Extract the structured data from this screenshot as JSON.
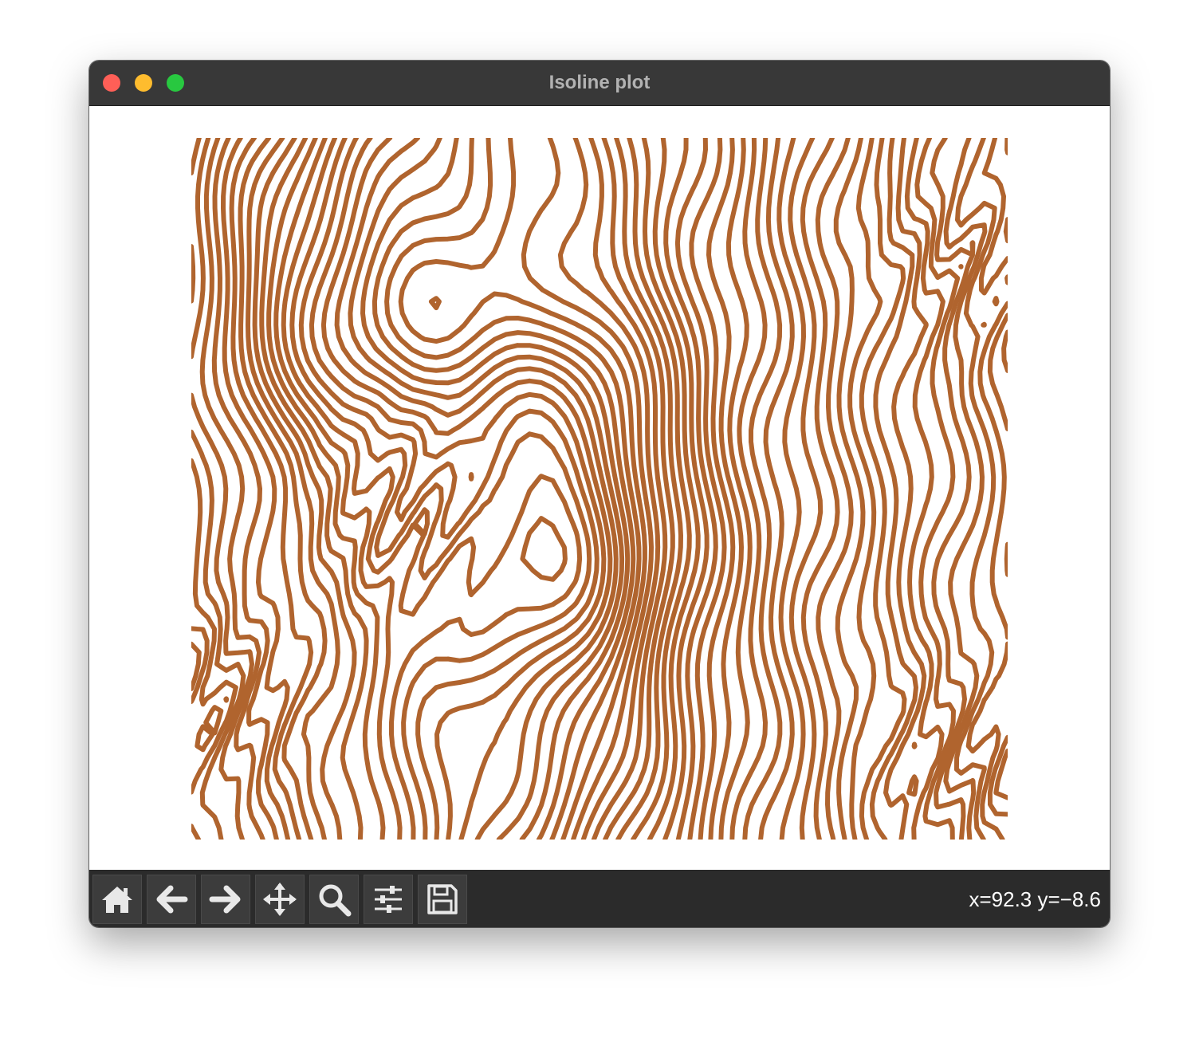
{
  "window": {
    "title": "Isoline plot",
    "traffic_lights": {
      "close": "#ff5f57",
      "minimize": "#febc2e",
      "zoom": "#28c840"
    }
  },
  "toolbar": {
    "buttons": [
      {
        "name": "home-button",
        "icon": "home-icon"
      },
      {
        "name": "back-button",
        "icon": "arrow-left-icon"
      },
      {
        "name": "forward-button",
        "icon": "arrow-right-icon"
      },
      {
        "name": "pan-button",
        "icon": "move-arrows-icon"
      },
      {
        "name": "zoom-button",
        "icon": "magnifier-icon"
      },
      {
        "name": "configure-subplots-button",
        "icon": "sliders-icon"
      },
      {
        "name": "save-button",
        "icon": "floppy-disk-icon"
      }
    ],
    "coordinates": "x=92.3 y=−8.6"
  },
  "colors": {
    "titlebar": "#383838",
    "toolbar": "#2b2b2b",
    "isoline": "#b0642e"
  },
  "chart_data": {
    "type": "contour",
    "line_color": "#b0642e",
    "axes_visible": false,
    "grid": false,
    "legend": "none",
    "features": {
      "basin": {
        "x": 0.46,
        "y": 0.55
      },
      "dense_zones": [
        {
          "x": 0.04,
          "y": 0.8
        },
        {
          "x": 0.96,
          "y": 0.18
        },
        {
          "x": 0.94,
          "y": 0.88
        },
        {
          "x": 0.27,
          "y": 0.55
        }
      ]
    },
    "levels": 60
  }
}
